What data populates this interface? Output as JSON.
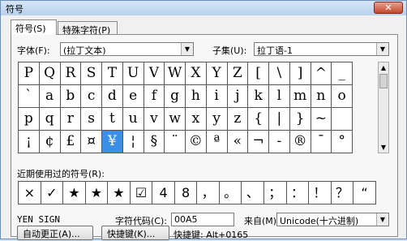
{
  "window": {
    "title": "符号",
    "close_symbol": "✕"
  },
  "tabs": [
    {
      "label": "符号(S)"
    },
    {
      "label": "特殊字符(P)"
    }
  ],
  "font": {
    "label": "字体(F):",
    "value": "(拉丁文本)"
  },
  "subset": {
    "label": "子集(U):",
    "value": "拉丁语-1"
  },
  "symbol_grid": [
    [
      "P",
      "Q",
      "R",
      "S",
      "T",
      "U",
      "V",
      "W",
      "X",
      "Y",
      "Z",
      "[",
      "\\",
      "]",
      "^",
      "_"
    ],
    [
      "`",
      "a",
      "b",
      "c",
      "d",
      "e",
      "f",
      "g",
      "h",
      "i",
      "j",
      "k",
      "l",
      "m",
      "n",
      "o"
    ],
    [
      "p",
      "q",
      "r",
      "s",
      "t",
      "u",
      "v",
      "w",
      "x",
      "y",
      "z",
      "{",
      "|",
      "}",
      "~",
      ""
    ],
    [
      "¡",
      "¢",
      "£",
      "¤",
      "¥",
      "¦",
      "§",
      "¨",
      "©",
      "ª",
      "«",
      "¬",
      "-",
      "®",
      "¯",
      "°"
    ]
  ],
  "selected_symbol": "¥",
  "recent": {
    "label": "近期使用过的符号(R):",
    "symbols": [
      "×",
      "✓",
      "★",
      "★",
      "★",
      "☑",
      "4",
      "8",
      "，",
      "。",
      "、",
      "；",
      "：",
      "！",
      "？",
      "“"
    ]
  },
  "char_name": "YEN SIGN",
  "char_code": {
    "label": "字符代码(C):",
    "value": "00A5"
  },
  "from": {
    "label": "来自(M):",
    "value": "Unicode(十六进制)"
  },
  "buttons": {
    "autocorrect": "自动更正(A)...",
    "shortcut_key": "快捷键(K)..."
  },
  "shortcut_text": "快捷键: Alt+0165"
}
